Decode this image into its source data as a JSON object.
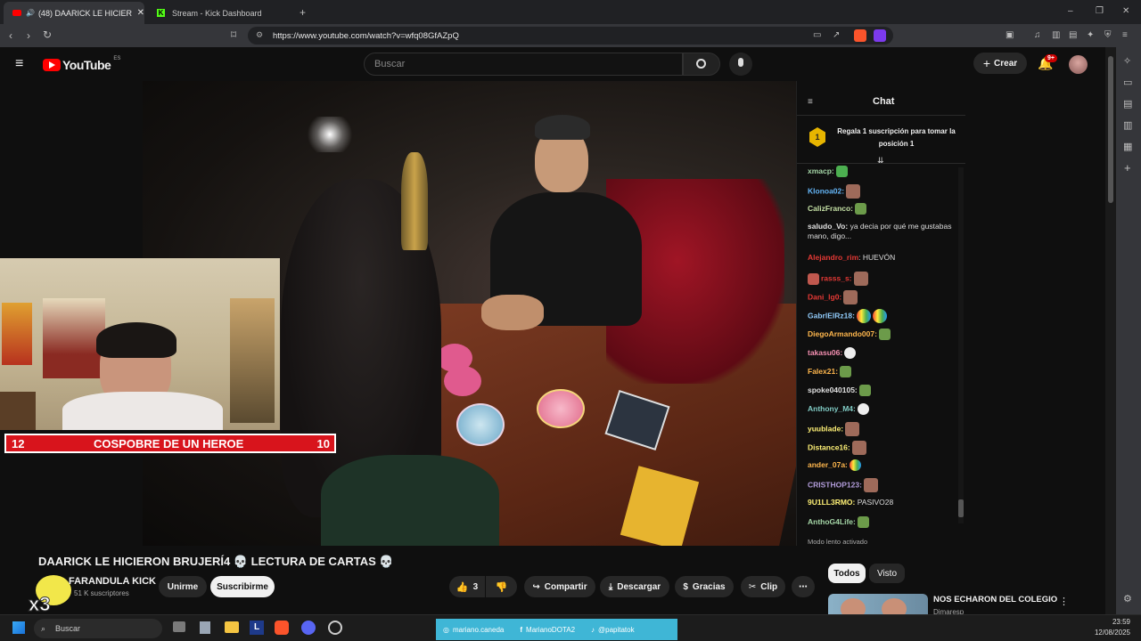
{
  "browser": {
    "tabs": [
      {
        "label": "(48) DAARICK LE HICIERON B",
        "active": true
      },
      {
        "label": "Stream - Kick Dashboard",
        "active": false
      }
    ],
    "url": "https://www.youtube.com/watch?v=wfq08GfAZpQ"
  },
  "youtube": {
    "logo": "YouTube",
    "region": "ES",
    "search_placeholder": "Buscar",
    "create_label": "Crear",
    "notif_count": "9+"
  },
  "overlay": {
    "left_num": "12",
    "banner_text": "COSPOBRE DE UN HEROE",
    "right_num": "10"
  },
  "chat": {
    "title": "Chat",
    "pinned": "Regala 1 suscripción para tomar la posición 1",
    "pinned_rank": "1",
    "messages": [
      {
        "user": "xmacp:",
        "text": "",
        "color": "#a5d6a7"
      },
      {
        "user": "Klonoa02:",
        "text": "",
        "color": "#64b5f6"
      },
      {
        "user": "CalizFranco:",
        "text": "",
        "color": "#c5e1a5"
      },
      {
        "user": "saludo_Vo:",
        "text": "ya decia por qué me gustabas mano, digo...",
        "color": "#e0e0e0"
      },
      {
        "user": "Alejandro_rim",
        "text": ": HUEVÓN",
        "color": "#e53935"
      },
      {
        "user": "rasss_s:",
        "text": "",
        "color": "#e53935"
      },
      {
        "user": "Dani_lg0:",
        "text": "",
        "color": "#e53935"
      },
      {
        "user": "GabrlElRz18:",
        "text": "",
        "color": "#90caf9"
      },
      {
        "user": "DiegoArmando007:",
        "text": "",
        "color": "#ffb74d"
      },
      {
        "user": "takasu06:",
        "text": "",
        "color": "#f48fb1"
      },
      {
        "user": "Falex21:",
        "text": "",
        "color": "#ffb74d"
      },
      {
        "user": "spoke040105:",
        "text": "",
        "color": "#e0e0e0"
      },
      {
        "user": "Anthony_M4:",
        "text": "",
        "color": "#80cbc4"
      },
      {
        "user": "yuublade:",
        "text": "",
        "color": "#fff176"
      },
      {
        "user": "Distance16:",
        "text": "",
        "color": "#fff176"
      },
      {
        "user": "ander_07a:",
        "text": "",
        "color": "#ffb74d"
      },
      {
        "user": "CRISTHOP123:",
        "text": "",
        "color": "#b39ddb"
      },
      {
        "user": "9U1LL3RMO:",
        "text": "PASIVO28",
        "color": "#fff176"
      },
      {
        "user": "AnthoG4Life:",
        "text": "",
        "color": "#a5d6a7"
      }
    ],
    "slow_mode": "Modo lento activado"
  },
  "video": {
    "title": "DAARICK LE HICIERON BRUJERÍ4 💀 LECTURA DE CARTAS 💀",
    "channel": "FARANDULA KICK",
    "subs": "51 K suscriptores",
    "unsub_label": "Unirme",
    "sub_label": "Suscribirme",
    "likes": "3",
    "share": "Compartir",
    "download": "Descargar",
    "thanks": "Gracias",
    "clip": "Clip",
    "avatar_text": "x3"
  },
  "recommend": {
    "filters": [
      "Todos",
      "Visto"
    ],
    "first_title": "NOS ECHARON DEL COLEGIO",
    "first_channel": "Dimaresp"
  },
  "taskbar": {
    "search": "Buscar",
    "links": [
      "mariano.caneda",
      "MarianoDOTA2",
      "@papitatok"
    ],
    "time": "23:59",
    "date": "12/08/2025"
  }
}
